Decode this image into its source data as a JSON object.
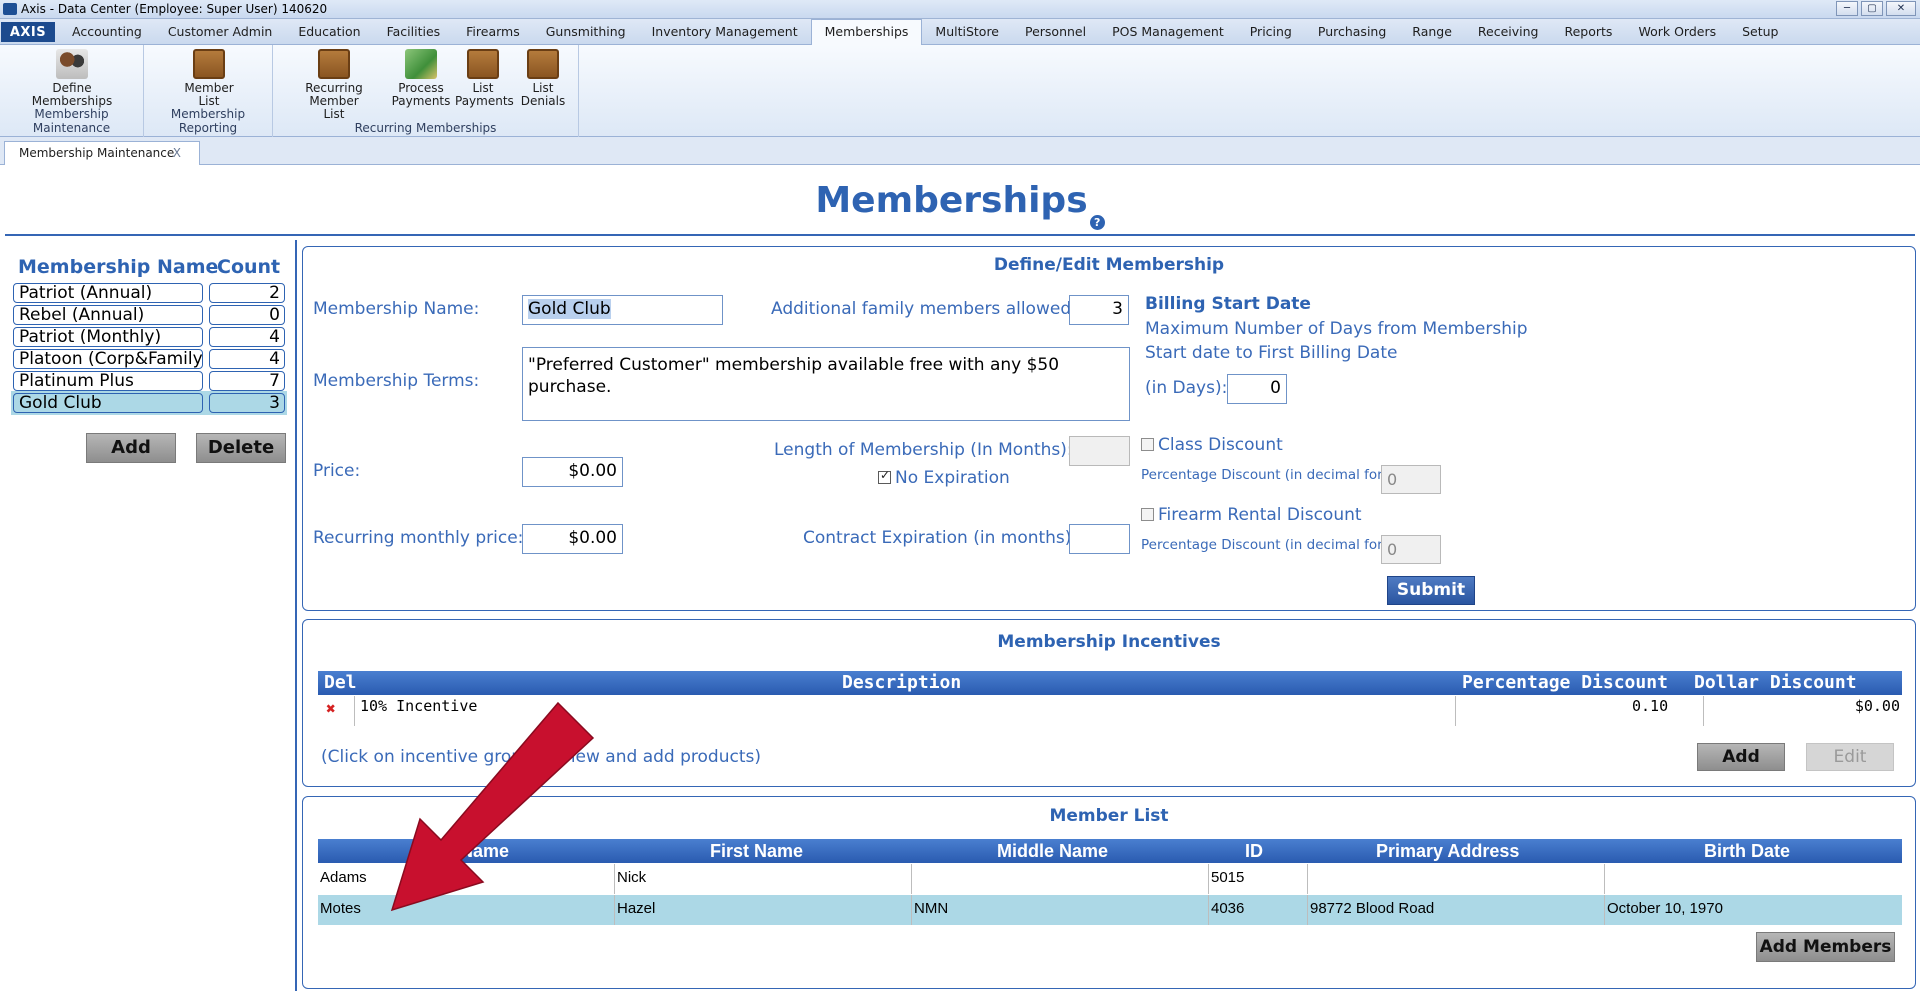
{
  "window": {
    "title": "Axis - Data Center  (Employee: Super User) 140620",
    "minimize": "─",
    "maximize": "▢",
    "close": "✕"
  },
  "menu": {
    "logo": "AXIS",
    "tabs": [
      "Accounting",
      "Customer Admin",
      "Education",
      "Facilities",
      "Firearms",
      "Gunsmithing",
      "Inventory Management",
      "Memberships",
      "MultiStore",
      "Personnel",
      "POS Management",
      "Pricing",
      "Purchasing",
      "Range",
      "Receiving",
      "Reports",
      "Work Orders",
      "Setup"
    ],
    "active": "Memberships"
  },
  "ribbon": {
    "groups": [
      {
        "label": "Membership Maintenance",
        "buttons": [
          {
            "line1": "Define",
            "line2": "Memberships",
            "icon": "people-icon"
          }
        ]
      },
      {
        "label": "Membership Reporting",
        "buttons": [
          {
            "line1": "Member",
            "line2": "List",
            "icon": "clipboard-icon"
          }
        ]
      },
      {
        "label": "Recurring Memberships",
        "buttons": [
          {
            "line1": "Recurring Member",
            "line2": "List",
            "icon": "clipboard-icon"
          },
          {
            "line1": "Process",
            "line2": "Payments",
            "icon": "money-icon"
          },
          {
            "line1": "List",
            "line2": "Payments",
            "icon": "checklist-icon"
          },
          {
            "line1": "List",
            "line2": "Denials",
            "icon": "denial-list-icon"
          }
        ]
      }
    ]
  },
  "doc_tab": {
    "label": "Membership Maintenance",
    "close": "X"
  },
  "page": {
    "title": "Memberships",
    "help": "?"
  },
  "memberships": {
    "header_name": "Membership Name",
    "header_count": "Count",
    "items": [
      {
        "name": "Patriot (Annual)",
        "count": "2"
      },
      {
        "name": "Rebel (Annual)",
        "count": "0"
      },
      {
        "name": "Patriot (Monthly)",
        "count": "4"
      },
      {
        "name": "Platoon (Corp&Family)",
        "count": "4"
      },
      {
        "name": "Platinum Plus",
        "count": "7"
      },
      {
        "name": "Gold Club",
        "count": "3"
      }
    ],
    "selected_index": 5,
    "add_label": "Add",
    "delete_label": "Delete"
  },
  "define": {
    "title": "Define/Edit Membership",
    "name_label": "Membership Name:",
    "name_value": "Gold Club",
    "family_label": "Additional family members allowed:",
    "family_value": "3",
    "terms_label": "Membership Terms:",
    "terms_value": "\"Preferred Customer\" membership available free with any $50 purchase.",
    "price_label": "Price:",
    "price_value": "$0.00",
    "recurring_label": "Recurring monthly price:",
    "recurring_value": "$0.00",
    "length_label": "Length of Membership (In Months):",
    "length_value": "",
    "no_expiration_label": "No Expiration",
    "no_expiration_checked": true,
    "contract_label": "Contract Expiration (in months):",
    "contract_value": "",
    "billing_title": "Billing Start Date",
    "billing_line1": "Maximum Number of Days from Membership",
    "billing_line2": "Start date to First Billing Date",
    "billing_line3": "(in Days):",
    "billing_value": "0",
    "class_discount_label": "Class Discount",
    "class_pct_label": "Percentage Discount (in decimal form)",
    "class_pct_value": "0",
    "firearm_discount_label": "Firearm Rental Discount",
    "firearm_pct_label": "Percentage Discount (in decimal form)",
    "firearm_pct_value": "0",
    "submit_label": "Submit"
  },
  "incentives": {
    "title": "Membership Incentives",
    "columns": {
      "del": "Del",
      "description": "Description",
      "pct": "Percentage Discount",
      "dollar": "Dollar Discount"
    },
    "rows": [
      {
        "description": "10% Incentive",
        "pct": "0.10",
        "dollar": "$0.00"
      }
    ],
    "hint": "(Click on incentive group to view and add products)",
    "add_label": "Add",
    "edit_label": "Edit"
  },
  "members": {
    "title": "Member List",
    "columns": {
      "last": "Last Name",
      "first": "First Name",
      "middle": "Middle Name",
      "id": "ID",
      "address": "Primary Address",
      "birth": "Birth Date"
    },
    "rows": [
      {
        "last": "Adams",
        "first": "Nick",
        "middle": "",
        "id": "5015",
        "address": "",
        "birth": ""
      },
      {
        "last": "Motes",
        "first": "Hazel",
        "middle": "NMN",
        "id": "4036",
        "address": "98772 Blood Road",
        "birth": "October 10, 1970"
      }
    ],
    "selected_index": 1,
    "add_members_label": "Add Members"
  },
  "colors": {
    "accent": "#2e63b2",
    "selected_row": "#acd8e6",
    "arrow": "#c8102e"
  }
}
